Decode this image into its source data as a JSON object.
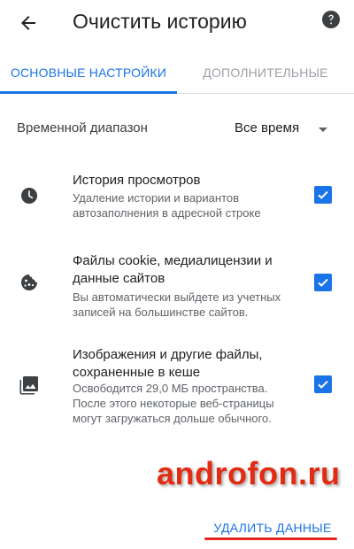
{
  "header": {
    "back_icon": "arrow-back-icon",
    "title": "Очистить историю",
    "help_icon": "help-circle-icon"
  },
  "tabs": [
    {
      "label": "ОСНОВНЫЕ НАСТРОЙКИ",
      "active": true
    },
    {
      "label": "ДОПОЛНИТЕЛЬНЫЕ",
      "active": false
    }
  ],
  "time_range": {
    "label": "Временной диапазон",
    "selected": "Все время",
    "caret_icon": "dropdown-arrow-icon"
  },
  "items": [
    {
      "icon": "clock-icon",
      "title": "История просмотров",
      "description": "Удаление истории и вариантов автозаполнения в адресной строке",
      "checked": true
    },
    {
      "icon": "cookie-icon",
      "title": "Файлы cookie, медиалицензии и данные сайтов",
      "description": "Вы автоматически выйдете из учетных записей на большинстве сайтов.",
      "checked": true
    },
    {
      "icon": "image-icon",
      "title": "Изображения и другие файлы, сохраненные в кеше",
      "description": "Освободится 29,0 МБ пространства. После этого некоторые веб-страницы могут загружаться дольше обычного.",
      "checked": true
    }
  ],
  "watermark": "androfon.ru",
  "actions": {
    "delete_label": "УДАЛИТЬ ДАННЫЕ"
  },
  "colors": {
    "accent": "#1a73e8",
    "text_primary": "#202124",
    "text_secondary": "#5f6368",
    "tab_inactive": "#9aa0a6",
    "icon": "#3c4043",
    "watermark": "#e32b12",
    "underline": "#e3261a"
  }
}
